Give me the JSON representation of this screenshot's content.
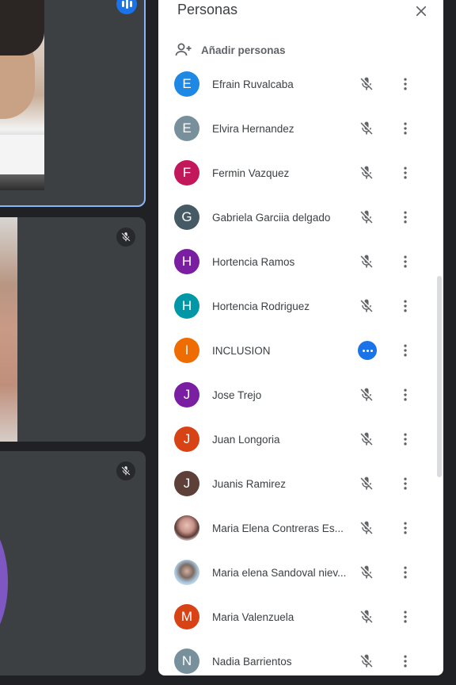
{
  "panel": {
    "title": "Personas",
    "add_people_label": "Añadir personas"
  },
  "participants": [
    {
      "name": "Efrain Ruvalcaba",
      "initial": "E",
      "color": "#1e88e5",
      "status": "muted"
    },
    {
      "name": "Elvira Hernandez",
      "initial": "E",
      "color": "#78909c",
      "status": "muted"
    },
    {
      "name": "Fermin Vazquez",
      "initial": "F",
      "color": "#c2185b",
      "status": "muted"
    },
    {
      "name": "Gabriela Garciia delgado",
      "initial": "G",
      "color": "#455a64",
      "status": "muted"
    },
    {
      "name": "Hortencia Ramos",
      "initial": "H",
      "color": "#7b1fa2",
      "status": "muted"
    },
    {
      "name": "Hortencia Rodriguez",
      "initial": "H",
      "color": "#0097a7",
      "status": "muted"
    },
    {
      "name": "INCLUSION",
      "initial": "I",
      "color": "#ef6c00",
      "status": "talking"
    },
    {
      "name": "Jose Trejo",
      "initial": "J",
      "color": "#7b1fa2",
      "status": "muted"
    },
    {
      "name": "Juan Longoria",
      "initial": "J",
      "color": "#d84315",
      "status": "muted"
    },
    {
      "name": "Juanis Ramirez",
      "initial": "J",
      "color": "#5d4037",
      "status": "muted"
    },
    {
      "name": "Maria Elena Contreras Es...",
      "initial": "",
      "color": "",
      "status": "muted"
    },
    {
      "name": "Maria elena Sandoval niev...",
      "initial": "",
      "color": "",
      "status": "muted"
    },
    {
      "name": "Maria Valenzuela",
      "initial": "M",
      "color": "#d84315",
      "status": "muted"
    },
    {
      "name": "Nadia Barrientos",
      "initial": "N",
      "color": "#78909c",
      "status": "muted"
    }
  ],
  "colors": {
    "accent": "#1a73e8",
    "active_tile_border": "#8ab4f8",
    "background": "#202124",
    "tile": "#3c4043"
  }
}
